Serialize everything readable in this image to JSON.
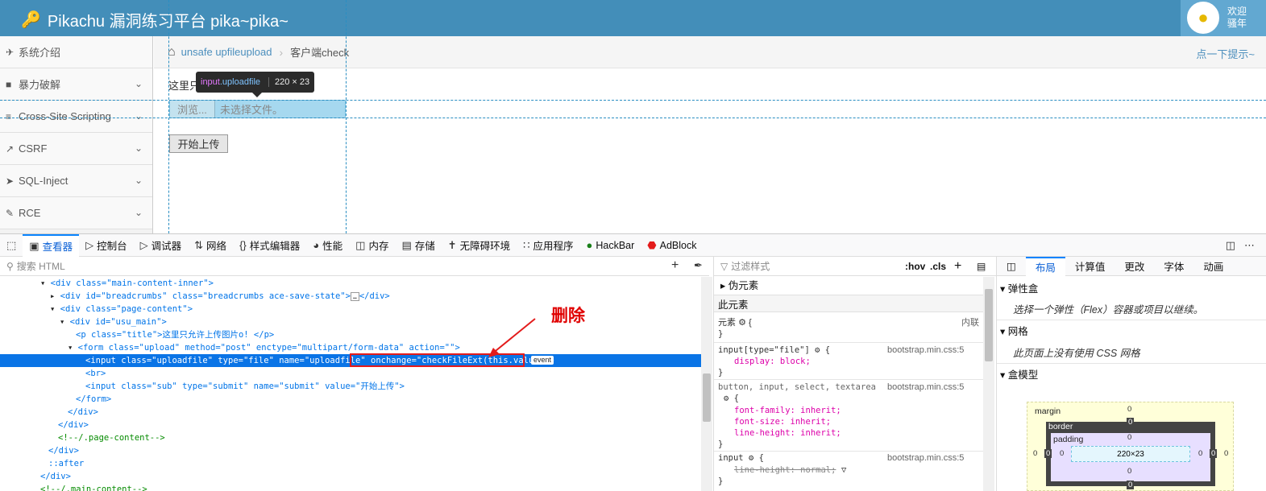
{
  "header": {
    "title": "Pikachu 漏洞练习平台 pika~pika~",
    "welcome_line1": "欢迎",
    "welcome_line2": "骚年"
  },
  "sidebar": {
    "items": [
      {
        "label": "系统介绍",
        "icon": "tag-icon",
        "expandable": false
      },
      {
        "label": "暴力破解",
        "icon": "lock-icon",
        "expandable": true
      },
      {
        "label": "Cross-Site Scripting",
        "icon": "list-icon",
        "expandable": true
      },
      {
        "label": "CSRF",
        "icon": "external-link-icon",
        "expandable": true
      },
      {
        "label": "SQL-Inject",
        "icon": "plane-icon",
        "expandable": true
      },
      {
        "label": "RCE",
        "icon": "pencil-icon",
        "expandable": true
      }
    ]
  },
  "breadcrumb": {
    "link": "unsafe upfileupload",
    "current": "客户端check",
    "hint": "点一下提示~"
  },
  "main": {
    "text": "这里只",
    "browse_label": "浏览...",
    "no_file": "未选择文件。",
    "submit_label": "开始上传"
  },
  "tooltip": {
    "tag": "input",
    "cls": ".uploadfile",
    "dims": "220 × 23"
  },
  "devtools": {
    "tabs": [
      "查看器",
      "控制台",
      "调试器",
      "网络",
      "样式编辑器",
      "性能",
      "内存",
      "存储",
      "无障碍环境",
      "应用程序",
      "HackBar",
      "AdBlock"
    ],
    "active_tab": "查看器",
    "search_html_placeholder": "搜索 HTML",
    "filter_styles_placeholder": "过滤样式",
    "hov": ":hov",
    "cls": ".cls",
    "annotation": "删除",
    "event_badge": "event",
    "html_lines": [
      "<div class=\"main-content-inner\">",
      "<div id=\"breadcrumbs\" class=\"breadcrumbs ace-save-state\">",
      "<div class=\"page-content\">",
      "<div id=\"usu_main\">",
      "<p class=\"title\">这里只允许上传图片o! </p>",
      "<form class=\"upload\" method=\"post\" enctype=\"multipart/form-data\" action=\"\">",
      "<input class=\"uploadfile\" type=\"file\" name=\"uploadfile\" onchange=\"checkFileExt(this.value)\">",
      "<br>",
      "<input class=\"sub\" type=\"submit\" name=\"submit\" value=\"开始上传\">",
      "</form>",
      "</div>",
      "</div>",
      "<!--/.page-content-->",
      "</div>",
      "::after",
      "</div>",
      "<!--/.main-content-->"
    ],
    "rules": {
      "pseudo": "伪元素",
      "this_element": "此元素",
      "element_label": "元素",
      "inline": "内联",
      "r1_selector": "input[type=\"file\"]",
      "r1_source": "bootstrap.min.css:5",
      "r1_decl": "display: block;",
      "r2_selector": "button, input, select, textarea",
      "r2_source": "bootstrap.min.css:5",
      "r2_decls": [
        "font-family: inherit;",
        "font-size: inherit;",
        "line-height: inherit;"
      ],
      "r3_selector": "input",
      "r3_source": "bootstrap.min.css:5",
      "r3_decl": "line-height: normal;"
    },
    "layout_tabs": [
      "布局",
      "计算值",
      "更改",
      "字体",
      "动画"
    ],
    "layout": {
      "flex_head": "弹性盒",
      "flex_note": "选择一个弹性（Flex）容器或项目以继续。",
      "grid_head": "网格",
      "grid_note": "此页面上没有使用 CSS 网格",
      "box_head": "盒模型",
      "margin": "margin",
      "border": "border",
      "padding": "padding",
      "content_size": "220×23",
      "zero": "0"
    }
  }
}
